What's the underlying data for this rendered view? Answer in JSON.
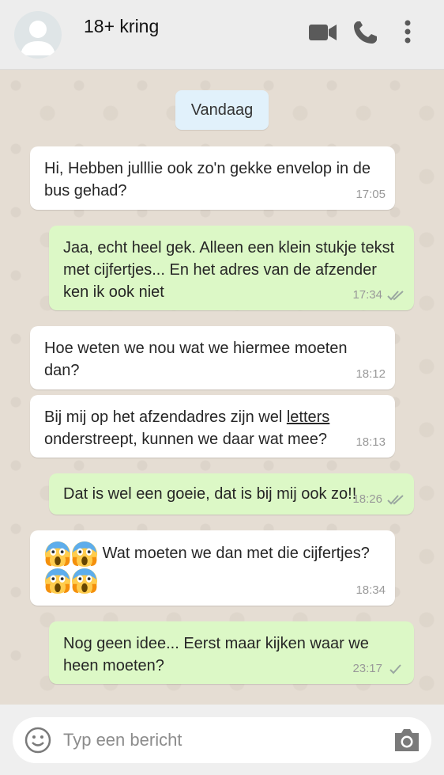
{
  "header": {
    "title": "18+ kring",
    "icons": [
      "avatar",
      "videocam-icon",
      "phone-icon",
      "more-vert-icon"
    ]
  },
  "date_separator": "Vandaag",
  "messages": [
    {
      "direction": "in",
      "text": "Hi, Hebben julllie ook zo'n gekke envelop in de bus gehad?",
      "time": "17:05"
    },
    {
      "direction": "out",
      "text": "Jaa, echt heel gek. Alleen een klein stukje tekst met cijfertjes... En het adres van de afzender ken ik ook niet",
      "time": "17:34",
      "status": "read"
    },
    {
      "direction": "in",
      "text": "Hoe weten we nou wat we hiermee moeten dan?",
      "time": "18:12"
    },
    {
      "direction": "in",
      "text_before": "Bij mij op het afzendadres zijn wel ",
      "text_underlined": "letters",
      "text_after": " onderstreept, kunnen we daar wat mee?",
      "time": "18:13"
    },
    {
      "direction": "out",
      "text": "Dat is wel een goeie, dat is bij mij ook zo!!",
      "time": "18:26",
      "status": "read"
    },
    {
      "direction": "in",
      "text_before": "Wat moeten we dan met die cijfertjes?",
      "emoji": "face-screaming-in-fear",
      "time": "18:34"
    },
    {
      "direction": "out",
      "text": "Nog geen idee... Eerst maar kijken waar we heen moeten?",
      "time": "23:17",
      "status": "sent"
    }
  ],
  "input": {
    "placeholder": "Typ een bericht",
    "value": "",
    "icons": [
      "emoji-icon",
      "camera-icon"
    ]
  },
  "colors": {
    "incoming_bubble": "#ffffff",
    "outgoing_bubble": "#dcf8c6",
    "date_pill": "#e1f1fb",
    "chat_background": "#e5ddd3",
    "read_tick": "#9aa7a0",
    "header": "#ededed"
  }
}
